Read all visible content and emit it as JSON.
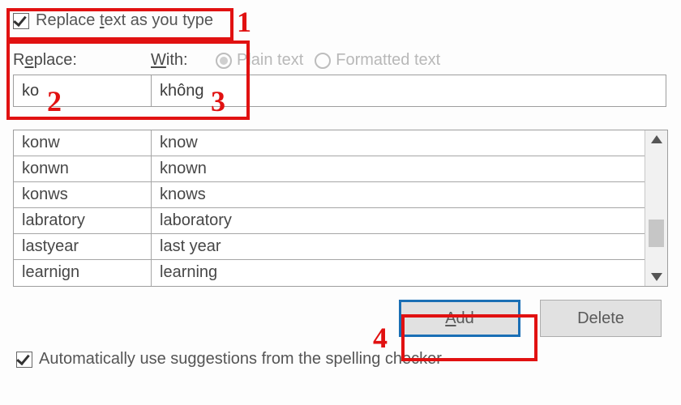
{
  "checkbox_replace_as_you_type": {
    "checked": true,
    "label_pre": "Replace ",
    "label_mn": "t",
    "label_post": "ext as you type"
  },
  "labels": {
    "replace_pre": "R",
    "replace_mn": "e",
    "replace_post": "place:",
    "with_mn": "W",
    "with_post": "ith:"
  },
  "radios": {
    "plain_text": "Plain text",
    "formatted_text": "Formatted text"
  },
  "inputs": {
    "replace_value": "ko",
    "with_value": "không"
  },
  "table": {
    "rows": [
      {
        "replace": "konw",
        "with": "know"
      },
      {
        "replace": "konwn",
        "with": "known"
      },
      {
        "replace": "konws",
        "with": "knows"
      },
      {
        "replace": "labratory",
        "with": "laboratory"
      },
      {
        "replace": "lastyear",
        "with": "last year"
      },
      {
        "replace": "learnign",
        "with": "learning"
      }
    ]
  },
  "buttons": {
    "add_mn": "A",
    "add_post": "dd",
    "delete": "Delete"
  },
  "checkbox_suggestions": {
    "checked": true,
    "label_pre": "Automatically use su",
    "label_mn": "g",
    "label_post": "gestions from the spelling checker"
  },
  "annotations": {
    "n1": "1",
    "n2": "2",
    "n3": "3",
    "n4": "4"
  }
}
